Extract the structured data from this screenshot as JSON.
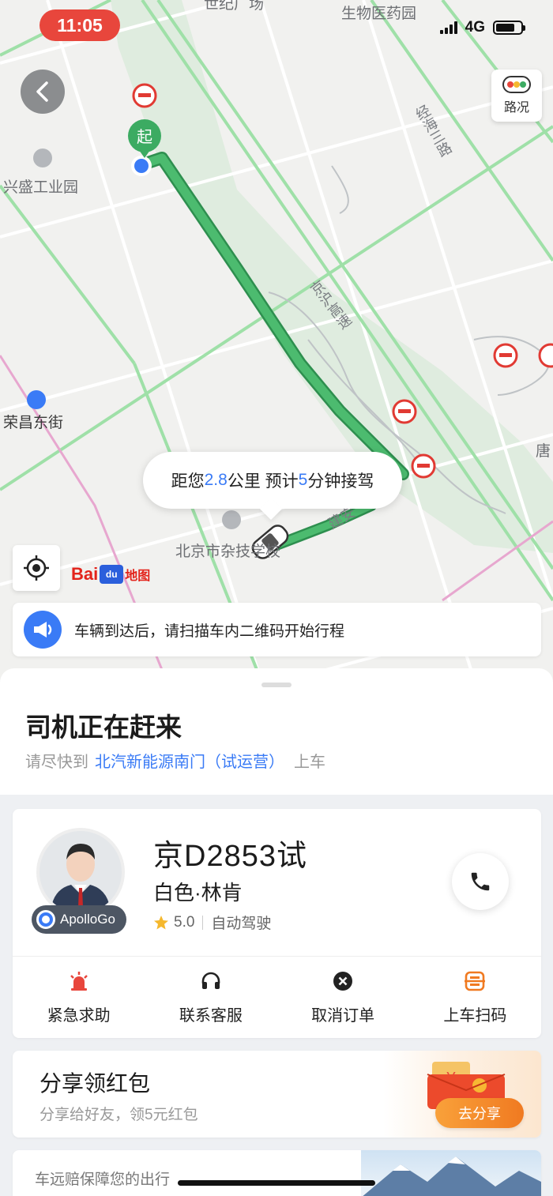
{
  "status_bar": {
    "time": "11:05",
    "network": "4G",
    "battery_level": 0.75
  },
  "map": {
    "labels": {
      "plaza": "世纪广场",
      "medicine_park": "生物医药园",
      "jinghai_road": "经海三路",
      "xingsheng": "兴盛工业园",
      "expressway": "京沪高速",
      "rongchang": "荣昌东街",
      "acrobatics_school": "北京市杂技学校",
      "jianan_road": "建安",
      "tang": "唐"
    },
    "start_marker": "起",
    "traffic_label": "路况",
    "eta": {
      "prefix": "距您",
      "distance": "2.8",
      "distance_unit": "公里",
      "mid": "预计",
      "minutes": "5",
      "suffix": "分钟接驾"
    },
    "logo": {
      "part1": "Bai",
      "part2": "du",
      "part3": "地图"
    },
    "notice": "车辆到达后，请扫描车内二维码开始行程"
  },
  "trip": {
    "title": "司机正在赶来",
    "subtitle_prefix": "请尽快到",
    "pickup_place": "北汽新能源南门（试运营）",
    "subtitle_suffix": "上车"
  },
  "vehicle": {
    "plate": "京D2853试",
    "desc": "白色·林肯",
    "rating": "5.0",
    "mode": "自动驾驶",
    "operator_tag": "ApolloGo"
  },
  "actions": [
    {
      "label": "紧急求助",
      "icon": "alarm-icon",
      "color": "#e8463c"
    },
    {
      "label": "联系客服",
      "icon": "headset-icon",
      "color": "#333333"
    },
    {
      "label": "取消订单",
      "icon": "cancel-icon",
      "color": "#333333"
    },
    {
      "label": "上车扫码",
      "icon": "scan-icon",
      "color": "#f07a21"
    }
  ],
  "share": {
    "title": "分享领红包",
    "subtitle": "分享给好友，领5元红包",
    "button": "去分享"
  },
  "insurance": {
    "text": "车远赔保障您的出行"
  },
  "colors": {
    "accent": "#3a7bf6",
    "route": "#3cab62",
    "alert": "#e8463c",
    "orange": "#f07a21"
  }
}
